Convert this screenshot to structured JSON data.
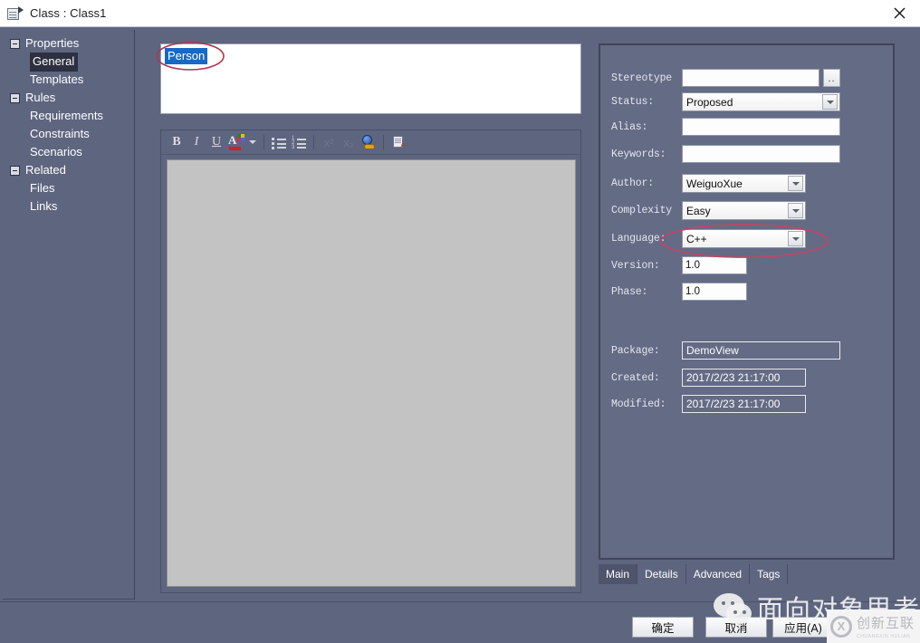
{
  "window": {
    "title": "Class : Class1",
    "icon": "class-document-icon",
    "close_label": "✕"
  },
  "sidebar": {
    "items": [
      {
        "label": "Properties",
        "level": 0,
        "expander": true,
        "selected": false
      },
      {
        "label": "General",
        "level": 1,
        "expander": false,
        "selected": true
      },
      {
        "label": "Templates",
        "level": 1,
        "expander": false,
        "selected": false
      },
      {
        "label": "Rules",
        "level": 0,
        "expander": true,
        "selected": false
      },
      {
        "label": "Requirements",
        "level": 1,
        "expander": false,
        "selected": false
      },
      {
        "label": "Constraints",
        "level": 1,
        "expander": false,
        "selected": false
      },
      {
        "label": "Scenarios",
        "level": 1,
        "expander": false,
        "selected": false
      },
      {
        "label": "Related",
        "level": 0,
        "expander": true,
        "selected": false
      },
      {
        "label": "Files",
        "level": 1,
        "expander": false,
        "selected": false
      },
      {
        "label": "Links",
        "level": 1,
        "expander": false,
        "selected": false
      }
    ]
  },
  "name_field": {
    "value": "Person",
    "selected": true
  },
  "notes_editor": {
    "toolbar": [
      {
        "name": "bold-button",
        "label": "B",
        "enabled": true
      },
      {
        "name": "italic-button",
        "label": "I",
        "enabled": true
      },
      {
        "name": "underline-button",
        "label": "U",
        "enabled": true
      },
      {
        "name": "font-color-button",
        "label": "A",
        "enabled": true
      },
      {
        "name": "font-color-dropdown",
        "label": "",
        "enabled": true
      },
      {
        "name": "bullet-list-button",
        "label": "",
        "enabled": true
      },
      {
        "name": "numbered-list-button",
        "label": "",
        "enabled": true
      },
      {
        "name": "superscript-button",
        "label": "x²",
        "enabled": false
      },
      {
        "name": "subscript-button",
        "label": "x₂",
        "enabled": false
      },
      {
        "name": "hyperlink-button",
        "label": "",
        "enabled": true
      },
      {
        "name": "insert-document-button",
        "label": "",
        "enabled": true
      }
    ],
    "content": ""
  },
  "properties": {
    "fields": [
      {
        "key": "stereotype",
        "label": "Stereotype",
        "value": "",
        "type": "text-with-picker"
      },
      {
        "key": "status",
        "label": "Status:",
        "value": "Proposed",
        "type": "combo-wide"
      },
      {
        "key": "alias",
        "label": "Alias:",
        "value": "",
        "type": "text"
      },
      {
        "key": "keywords",
        "label": "Keywords:",
        "value": "",
        "type": "text"
      },
      {
        "key": "author",
        "label": "Author:",
        "value": "WeiguoXue",
        "type": "combo"
      },
      {
        "key": "complexity",
        "label": "Complexity",
        "value": "Easy",
        "type": "combo"
      },
      {
        "key": "language",
        "label": "Language:",
        "value": "C++",
        "type": "combo"
      },
      {
        "key": "version",
        "label": "Version:",
        "value": "1.0",
        "type": "small-text"
      },
      {
        "key": "phase",
        "label": "Phase:",
        "value": "1.0",
        "type": "small-text"
      },
      {
        "key": "package",
        "label": "Package:",
        "value": "DemoView",
        "type": "readonly-wide"
      },
      {
        "key": "created",
        "label": "Created:",
        "value": "2017/2/23 21:17:00",
        "type": "readonly"
      },
      {
        "key": "modified",
        "label": "Modified:",
        "value": "2017/2/23 21:17:00",
        "type": "readonly"
      }
    ],
    "picker_label": ".."
  },
  "tabs": [
    {
      "label": "Main",
      "active": true
    },
    {
      "label": "Details",
      "active": false
    },
    {
      "label": "Advanced",
      "active": false
    },
    {
      "label": "Tags",
      "active": false
    }
  ],
  "footer": {
    "ok_label": "确定",
    "cancel_label": "取消",
    "apply_label": "应用(A)"
  },
  "annotations": [
    {
      "name": "name-field-highlight",
      "shape": "ellipse",
      "color": "#b0344a"
    },
    {
      "name": "language-field-highlight",
      "shape": "ellipse",
      "color": "#c0486a"
    }
  ],
  "watermarks": {
    "wechat_text": "面向对象思考",
    "brand_main": "创新互联",
    "brand_sub": "CHUANGXIN  HULIAN",
    "brand_mark": "X"
  },
  "colors": {
    "window_bg": "#5e657f",
    "panel_bg": "#646b85",
    "selection_blue": "#1569c7",
    "notes_bg": "#c3c3c3",
    "annotation_red": "#b0344a"
  }
}
